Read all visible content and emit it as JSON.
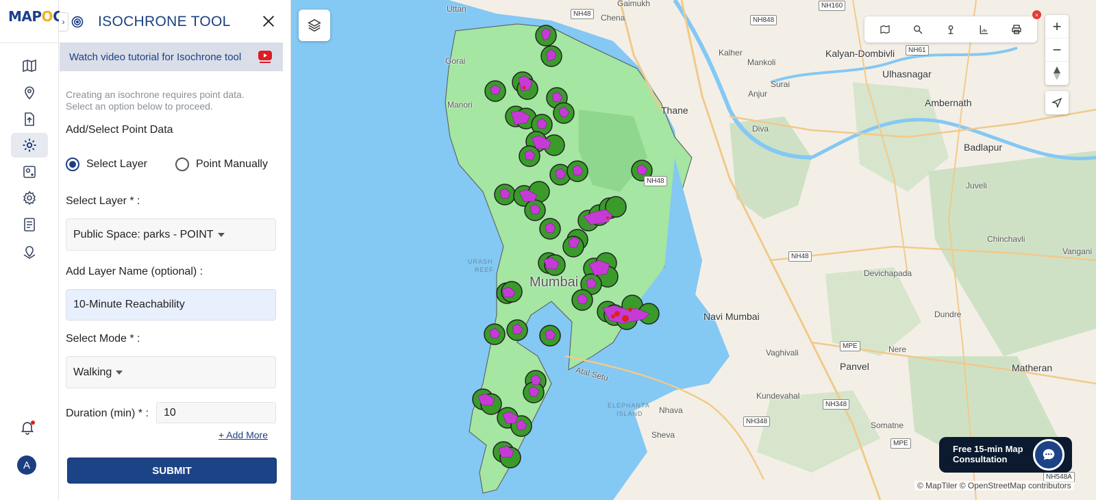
{
  "app": {
    "logo_text": "MAPOG"
  },
  "rail": {
    "items": [
      {
        "name": "map-icon"
      },
      {
        "name": "location-pin-icon"
      },
      {
        "name": "file-upload-icon"
      },
      {
        "name": "gear-tools-icon",
        "active": true
      },
      {
        "name": "map-settings-icon"
      },
      {
        "name": "settings-icon"
      },
      {
        "name": "report-icon"
      },
      {
        "name": "map-marker-check-icon"
      }
    ],
    "avatar_initial": "A"
  },
  "panel": {
    "title": "ISOCHRONE TOOL",
    "tutorial_text": "Watch video tutorial for Isochrone tool",
    "description": "Creating an isochrone requires point data. Select an option below to proceed.",
    "section_title": "Add/Select Point Data",
    "radio_select_layer": "Select Layer",
    "radio_point_manually": "Point Manually",
    "select_layer_label": "Select Layer * :",
    "select_layer_value": "Public Space: parks - POINT",
    "layer_name_label": "Add Layer Name (optional) :",
    "layer_name_value": "10-Minute Reachability",
    "mode_label": "Select Mode * :",
    "mode_value": "Walking",
    "duration_label": "Duration (min) * :",
    "duration_value": "10",
    "add_more": "+ Add More",
    "submit": "SUBMIT"
  },
  "map": {
    "places": [
      {
        "text": "Uttan",
        "cls": "small"
      },
      {
        "text": "Gaimukh",
        "cls": "small"
      },
      {
        "text": "Chena",
        "cls": "small"
      },
      {
        "text": "Gorai",
        "cls": "small"
      },
      {
        "text": "Manori",
        "cls": "small"
      },
      {
        "text": "Kalher",
        "cls": "small"
      },
      {
        "text": "Mankoli",
        "cls": "small"
      },
      {
        "text": "Anjur",
        "cls": "small"
      },
      {
        "text": "Surai",
        "cls": "small"
      },
      {
        "text": "Kalyan-Dombivli",
        "cls": ""
      },
      {
        "text": "Ulhasnagar",
        "cls": ""
      },
      {
        "text": "Ambernath",
        "cls": ""
      },
      {
        "text": "Thane",
        "cls": ""
      },
      {
        "text": "Diva",
        "cls": "small"
      },
      {
        "text": "Badlapur",
        "cls": ""
      },
      {
        "text": "Juveli",
        "cls": "small"
      },
      {
        "text": "Chinchavli",
        "cls": "small"
      },
      {
        "text": "Devichapada",
        "cls": "small"
      },
      {
        "text": "Vangani",
        "cls": "small"
      },
      {
        "text": "Mumbai",
        "cls": "big"
      },
      {
        "text": "Navi Mumbai",
        "cls": ""
      },
      {
        "text": "Dundre",
        "cls": "small"
      },
      {
        "text": "Vaghivali",
        "cls": "small"
      },
      {
        "text": "Panvel",
        "cls": ""
      },
      {
        "text": "Nere",
        "cls": "small"
      },
      {
        "text": "Matheran",
        "cls": ""
      },
      {
        "text": "Kundevahal",
        "cls": "small"
      },
      {
        "text": "Nhava",
        "cls": "small"
      },
      {
        "text": "Sheva",
        "cls": "small"
      },
      {
        "text": "Somatne",
        "cls": "small"
      },
      {
        "text": "Atal Setu",
        "cls": "small"
      }
    ],
    "water_labels": [
      "URASH",
      "REEF",
      "ELEPHANTA",
      "ISLAND"
    ],
    "highways": [
      "NH48",
      "NH848",
      "NH160",
      "NH61",
      "NH48",
      "NH48",
      "MPE",
      "NH348",
      "NH348",
      "MPE",
      "NH548A"
    ],
    "consultation": "Free 15-min Map Consultation",
    "attribution": "© MapTiler © OpenStreetMap contributors"
  }
}
